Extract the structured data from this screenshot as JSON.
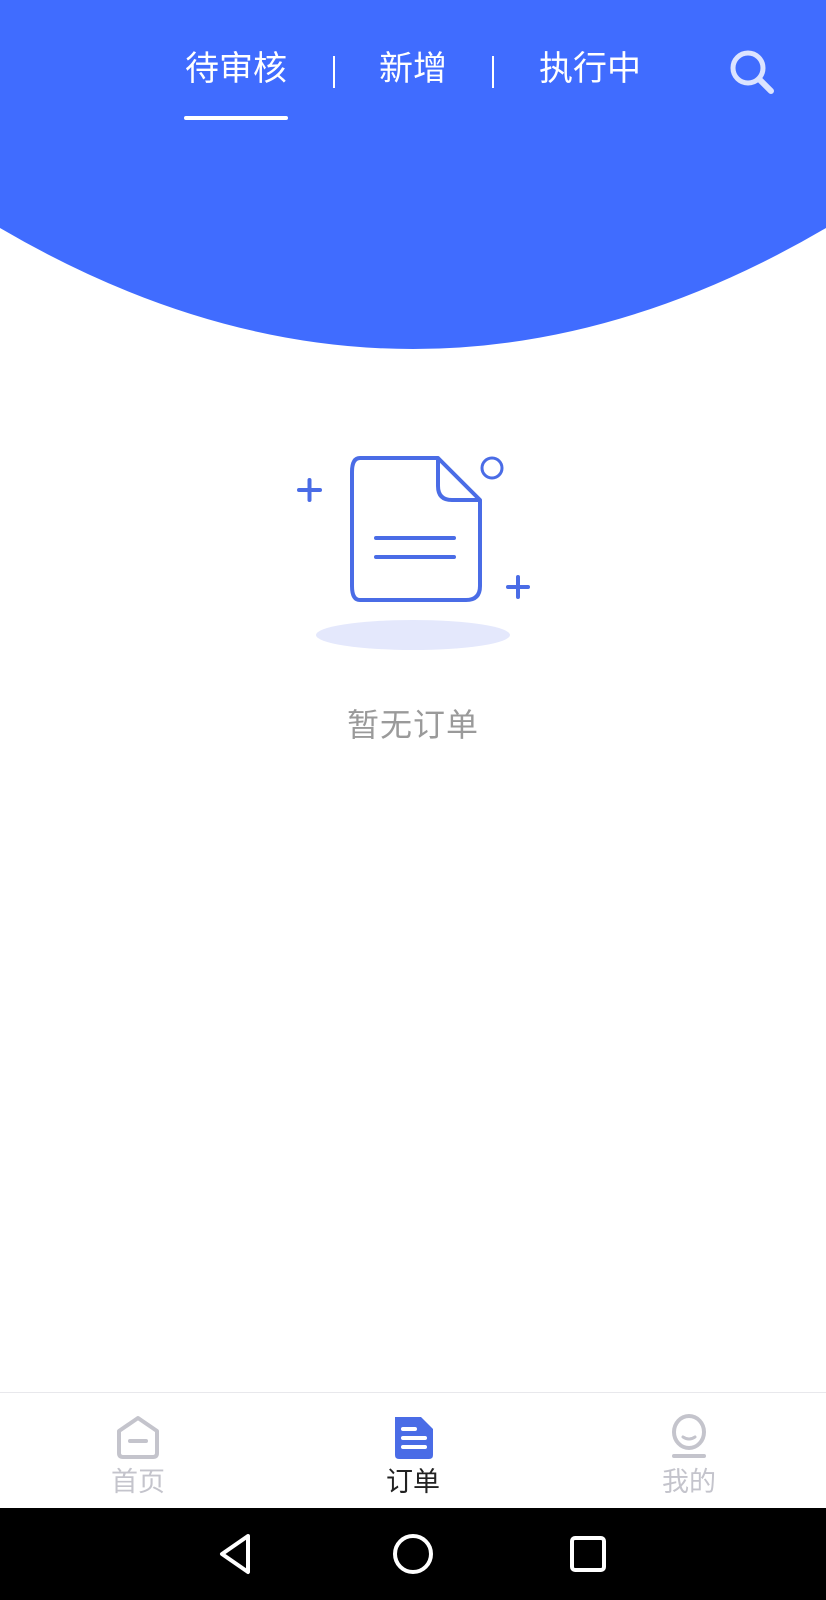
{
  "header": {
    "tabs": [
      {
        "label": "待审核",
        "active": true
      },
      {
        "label": "新增",
        "active": false
      },
      {
        "label": "执行中",
        "active": false
      }
    ],
    "search_icon": "search-icon"
  },
  "empty_state": {
    "icon": "document-icon",
    "message": "暂无订单"
  },
  "bottom_nav": {
    "items": [
      {
        "label": "首页",
        "icon": "home-icon",
        "active": false
      },
      {
        "label": "订单",
        "icon": "orders-icon",
        "active": true
      },
      {
        "label": "我的",
        "icon": "profile-icon",
        "active": false
      }
    ]
  },
  "system_nav": {
    "icons": [
      "back-icon",
      "home-circle-icon",
      "recent-apps-icon"
    ]
  },
  "colors": {
    "primary": "#406CFF",
    "illustration_stroke": "#4A6CE6",
    "illustration_shadow": "#E4E8FC",
    "inactive": "#C4C4CC",
    "empty_text": "#9A9A9A"
  }
}
